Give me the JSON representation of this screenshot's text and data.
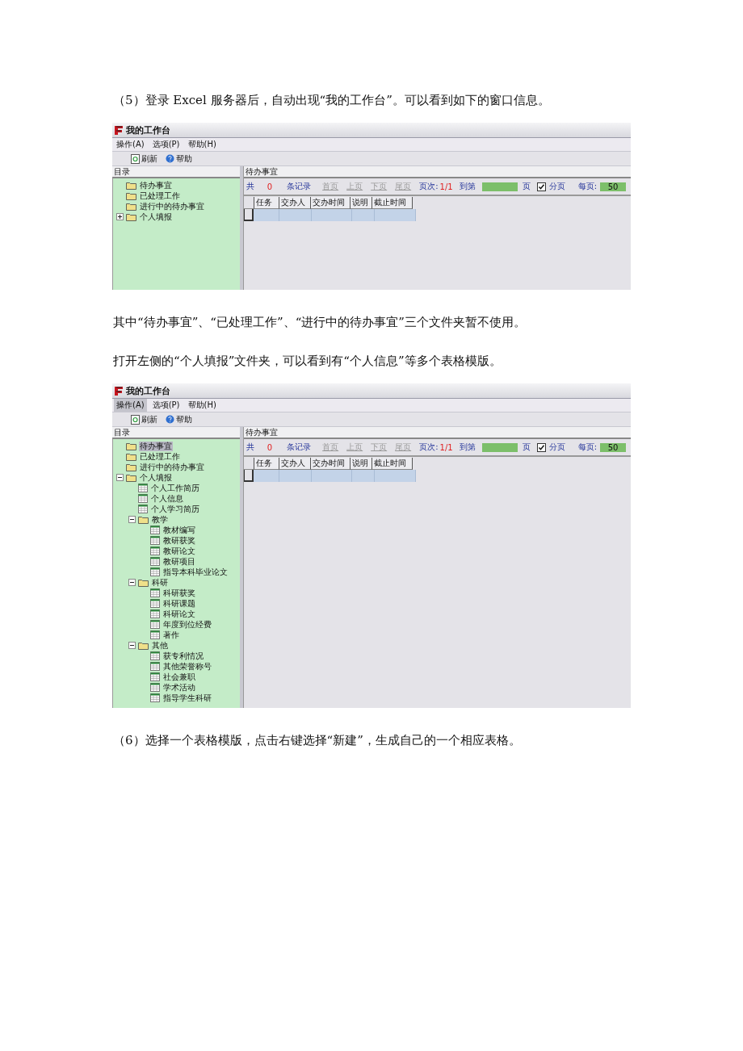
{
  "blocks": [
    {
      "kind": "paragraph",
      "text": "（5）登录 Excel 服务器后，自动出现“我的工作台”。可以看到如下的窗口信息。"
    },
    {
      "kind": "window",
      "title": "我的工作台",
      "menu": [
        {
          "label": "操作(A)",
          "selected": false
        },
        {
          "label": "选项(P)",
          "selected": false
        },
        {
          "label": "帮助(H)",
          "selected": false
        }
      ],
      "toolbar": [
        "刷新",
        "帮助"
      ],
      "tree_header": "目录",
      "tree": [
        {
          "kind": "folder",
          "label": "待办事宜",
          "selected": false
        },
        {
          "kind": "folder",
          "label": "已处理工作",
          "selected": false
        },
        {
          "kind": "folder",
          "label": "进行中的待办事宜",
          "selected": false
        },
        {
          "kind": "folder",
          "label": "个人填报",
          "selected": false,
          "expanded": false
        }
      ],
      "panel_title": "待办事宜",
      "pager": {
        "total_label": "共",
        "total": "0",
        "records_label": "条记录",
        "nav": [
          "首页",
          "上页",
          "下页",
          "尾页"
        ],
        "page_label": "页次:",
        "page": "1/1",
        "goto_label": "到第",
        "goto_unit": "页",
        "paging_checked": true,
        "paging_label": "分页",
        "per_page_label": "每页:",
        "per_page": "50"
      },
      "columns": [
        "任务",
        "交办人",
        "交办时间",
        "说明",
        "截止时间"
      ]
    },
    {
      "kind": "paragraph",
      "text": "其中“待办事宜”、“已处理工作”、“进行中的待办事宜”三个文件夹暂不使用。"
    },
    {
      "kind": "paragraph",
      "text": "打开左侧的“个人填报”文件夹，可以看到有“个人信息”等多个表格模版。"
    },
    {
      "kind": "window",
      "title": "我的工作台",
      "menu": [
        {
          "label": "操作(A)",
          "selected": true
        },
        {
          "label": "选项(P)",
          "selected": false
        },
        {
          "label": "帮助(H)",
          "selected": false
        }
      ],
      "toolbar": [
        "刷新",
        "帮助"
      ],
      "tree_header": "目录",
      "tree": [
        {
          "kind": "folder",
          "label": "待办事宜",
          "selected": true
        },
        {
          "kind": "folder",
          "label": "已处理工作",
          "selected": false
        },
        {
          "kind": "folder",
          "label": "进行中的待办事宜",
          "selected": false
        },
        {
          "kind": "folder",
          "label": "个人填报",
          "selected": false,
          "expanded": true,
          "children": [
            {
              "kind": "form",
              "label": "个人工作简历",
              "selected": false
            },
            {
              "kind": "form",
              "label": "个人信息",
              "selected": false
            },
            {
              "kind": "form",
              "label": "个人学习简历",
              "selected": false
            },
            {
              "kind": "folder",
              "label": "教学",
              "selected": false,
              "expanded": true,
              "children": [
                {
                  "kind": "form",
                  "label": "教材编写",
                  "selected": false
                },
                {
                  "kind": "form",
                  "label": "教研获奖",
                  "selected": false
                },
                {
                  "kind": "form",
                  "label": "教研论文",
                  "selected": false
                },
                {
                  "kind": "form",
                  "label": "教研项目",
                  "selected": false
                },
                {
                  "kind": "form",
                  "label": "指导本科毕业论文",
                  "selected": false
                }
              ]
            },
            {
              "kind": "folder",
              "label": "科研",
              "selected": false,
              "expanded": true,
              "children": [
                {
                  "kind": "form",
                  "label": "科研获奖",
                  "selected": false
                },
                {
                  "kind": "form",
                  "label": "科研课题",
                  "selected": false
                },
                {
                  "kind": "form",
                  "label": "科研论文",
                  "selected": false
                },
                {
                  "kind": "form",
                  "label": "年度到位经费",
                  "selected": false
                },
                {
                  "kind": "form",
                  "label": "著作",
                  "selected": false
                }
              ]
            },
            {
              "kind": "folder",
              "label": "其他",
              "selected": false,
              "expanded": true,
              "children": [
                {
                  "kind": "form",
                  "label": "获专利情况",
                  "selected": false
                },
                {
                  "kind": "form",
                  "label": "其他荣誉称号",
                  "selected": false
                },
                {
                  "kind": "form",
                  "label": "社会兼职",
                  "selected": false
                },
                {
                  "kind": "form",
                  "label": "学术活动",
                  "selected": false
                },
                {
                  "kind": "form",
                  "label": "指导学生科研",
                  "selected": false
                }
              ]
            }
          ]
        }
      ],
      "panel_title": "待办事宜",
      "pager": {
        "total_label": "共",
        "total": "0",
        "records_label": "条记录",
        "nav": [
          "首页",
          "上页",
          "下页",
          "尾页"
        ],
        "page_label": "页次:",
        "page": "1/1",
        "goto_label": "到第",
        "goto_unit": "页",
        "paging_checked": true,
        "paging_label": "分页",
        "per_page_label": "每页:",
        "per_page": "50"
      },
      "columns": [
        "任务",
        "交办人",
        "交办时间",
        "说明",
        "截止时间"
      ]
    },
    {
      "kind": "paragraph",
      "text": "（6）选择一个表格模版，点击右键选择“新建”，生成自己的一个相应表格。"
    }
  ]
}
